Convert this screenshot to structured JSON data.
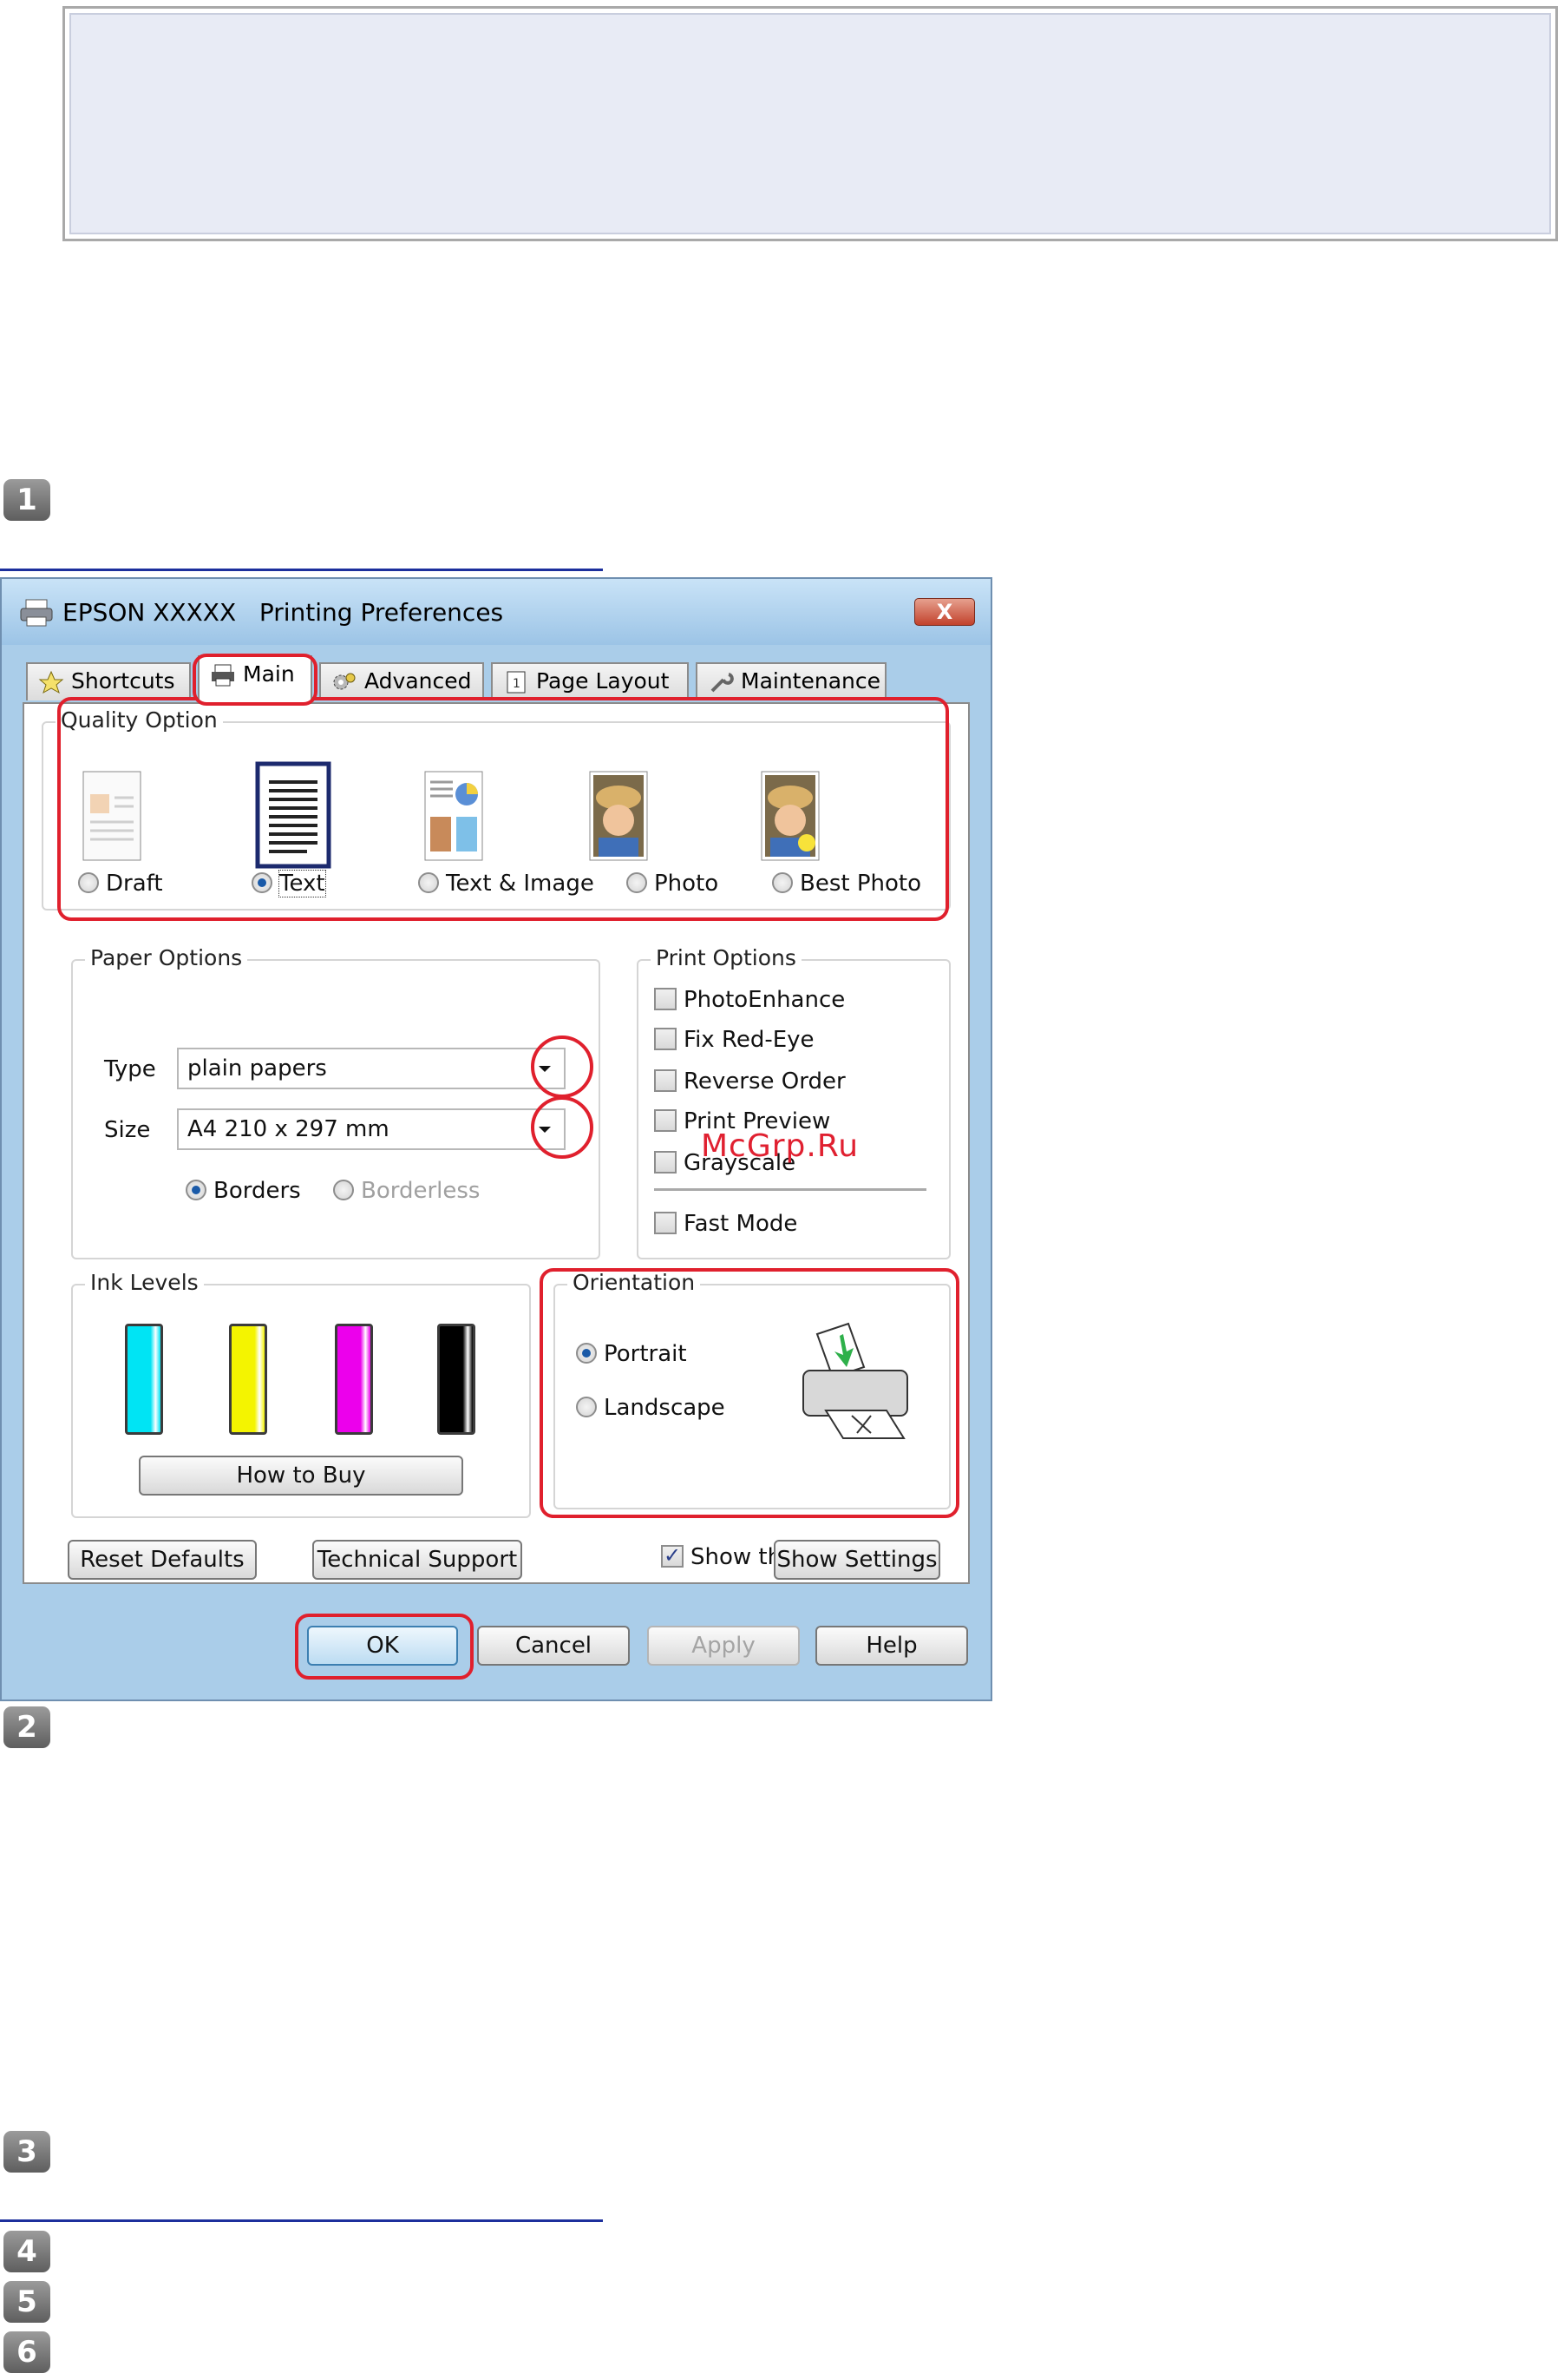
{
  "steps": [
    "1",
    "2",
    "3",
    "4",
    "5",
    "6"
  ],
  "dialog": {
    "title": "EPSON XXXXX   Printing Preferences",
    "close_label": "X",
    "tabs": [
      {
        "label": "Shortcuts",
        "icon": "star-icon"
      },
      {
        "label": "Main",
        "icon": "printer-icon"
      },
      {
        "label": "Advanced",
        "icon": "gears-icon"
      },
      {
        "label": "Page Layout",
        "icon": "page-icon"
      },
      {
        "label": "Maintenance",
        "icon": "wrench-icon"
      }
    ],
    "quality": {
      "label": "Quality Option",
      "options": [
        "Draft",
        "Text",
        "Text & Image",
        "Photo",
        "Best Photo"
      ],
      "selected": "Text"
    },
    "paper": {
      "label": "Paper Options",
      "type_label": "Type",
      "type_value": "plain papers",
      "size_label": "Size",
      "size_value": "A4 210 x 297 mm",
      "borders_label": "Borders",
      "borderless_label": "Borderless"
    },
    "print_options": {
      "label": "Print Options",
      "items": [
        "PhotoEnhance",
        "Fix Red-Eye",
        "Reverse Order",
        "Print Preview",
        "Grayscale",
        "Fast Mode"
      ]
    },
    "ink": {
      "label": "Ink Levels",
      "colors": [
        "#00e4f4",
        "#f4f400",
        "#ec00ec",
        "#000000"
      ],
      "how_to_buy": "How to Buy"
    },
    "orientation": {
      "label": "Orientation",
      "portrait": "Portrait",
      "landscape": "Landscape",
      "selected": "Portrait"
    },
    "show_screen_first": "Show this screen first",
    "buttons": {
      "reset": "Reset Defaults",
      "tech": "Technical Support",
      "show_settings": "Show Settings",
      "ok": "OK",
      "cancel": "Cancel",
      "apply": "Apply",
      "help": "Help"
    }
  },
  "watermark": "McGrp.Ru",
  "colors": {
    "highlight": "#e0202d",
    "link_rule": "#1c2f9c"
  }
}
